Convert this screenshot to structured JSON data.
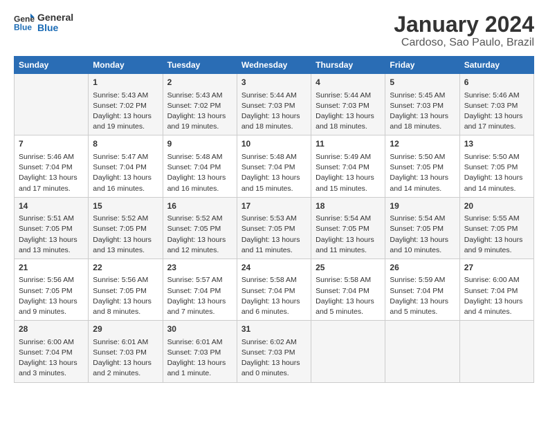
{
  "header": {
    "logo_line1": "General",
    "logo_line2": "Blue",
    "title": "January 2024",
    "subtitle": "Cardoso, Sao Paulo, Brazil"
  },
  "columns": [
    "Sunday",
    "Monday",
    "Tuesday",
    "Wednesday",
    "Thursday",
    "Friday",
    "Saturday"
  ],
  "weeks": [
    [
      {
        "day": "",
        "sunrise": "",
        "sunset": "",
        "daylight": ""
      },
      {
        "day": "1",
        "sunrise": "Sunrise: 5:43 AM",
        "sunset": "Sunset: 7:02 PM",
        "daylight": "Daylight: 13 hours and 19 minutes."
      },
      {
        "day": "2",
        "sunrise": "Sunrise: 5:43 AM",
        "sunset": "Sunset: 7:02 PM",
        "daylight": "Daylight: 13 hours and 19 minutes."
      },
      {
        "day": "3",
        "sunrise": "Sunrise: 5:44 AM",
        "sunset": "Sunset: 7:03 PM",
        "daylight": "Daylight: 13 hours and 18 minutes."
      },
      {
        "day": "4",
        "sunrise": "Sunrise: 5:44 AM",
        "sunset": "Sunset: 7:03 PM",
        "daylight": "Daylight: 13 hours and 18 minutes."
      },
      {
        "day": "5",
        "sunrise": "Sunrise: 5:45 AM",
        "sunset": "Sunset: 7:03 PM",
        "daylight": "Daylight: 13 hours and 18 minutes."
      },
      {
        "day": "6",
        "sunrise": "Sunrise: 5:46 AM",
        "sunset": "Sunset: 7:03 PM",
        "daylight": "Daylight: 13 hours and 17 minutes."
      }
    ],
    [
      {
        "day": "7",
        "sunrise": "Sunrise: 5:46 AM",
        "sunset": "Sunset: 7:04 PM",
        "daylight": "Daylight: 13 hours and 17 minutes."
      },
      {
        "day": "8",
        "sunrise": "Sunrise: 5:47 AM",
        "sunset": "Sunset: 7:04 PM",
        "daylight": "Daylight: 13 hours and 16 minutes."
      },
      {
        "day": "9",
        "sunrise": "Sunrise: 5:48 AM",
        "sunset": "Sunset: 7:04 PM",
        "daylight": "Daylight: 13 hours and 16 minutes."
      },
      {
        "day": "10",
        "sunrise": "Sunrise: 5:48 AM",
        "sunset": "Sunset: 7:04 PM",
        "daylight": "Daylight: 13 hours and 15 minutes."
      },
      {
        "day": "11",
        "sunrise": "Sunrise: 5:49 AM",
        "sunset": "Sunset: 7:04 PM",
        "daylight": "Daylight: 13 hours and 15 minutes."
      },
      {
        "day": "12",
        "sunrise": "Sunrise: 5:50 AM",
        "sunset": "Sunset: 7:05 PM",
        "daylight": "Daylight: 13 hours and 14 minutes."
      },
      {
        "day": "13",
        "sunrise": "Sunrise: 5:50 AM",
        "sunset": "Sunset: 7:05 PM",
        "daylight": "Daylight: 13 hours and 14 minutes."
      }
    ],
    [
      {
        "day": "14",
        "sunrise": "Sunrise: 5:51 AM",
        "sunset": "Sunset: 7:05 PM",
        "daylight": "Daylight: 13 hours and 13 minutes."
      },
      {
        "day": "15",
        "sunrise": "Sunrise: 5:52 AM",
        "sunset": "Sunset: 7:05 PM",
        "daylight": "Daylight: 13 hours and 13 minutes."
      },
      {
        "day": "16",
        "sunrise": "Sunrise: 5:52 AM",
        "sunset": "Sunset: 7:05 PM",
        "daylight": "Daylight: 13 hours and 12 minutes."
      },
      {
        "day": "17",
        "sunrise": "Sunrise: 5:53 AM",
        "sunset": "Sunset: 7:05 PM",
        "daylight": "Daylight: 13 hours and 11 minutes."
      },
      {
        "day": "18",
        "sunrise": "Sunrise: 5:54 AM",
        "sunset": "Sunset: 7:05 PM",
        "daylight": "Daylight: 13 hours and 11 minutes."
      },
      {
        "day": "19",
        "sunrise": "Sunrise: 5:54 AM",
        "sunset": "Sunset: 7:05 PM",
        "daylight": "Daylight: 13 hours and 10 minutes."
      },
      {
        "day": "20",
        "sunrise": "Sunrise: 5:55 AM",
        "sunset": "Sunset: 7:05 PM",
        "daylight": "Daylight: 13 hours and 9 minutes."
      }
    ],
    [
      {
        "day": "21",
        "sunrise": "Sunrise: 5:56 AM",
        "sunset": "Sunset: 7:05 PM",
        "daylight": "Daylight: 13 hours and 9 minutes."
      },
      {
        "day": "22",
        "sunrise": "Sunrise: 5:56 AM",
        "sunset": "Sunset: 7:05 PM",
        "daylight": "Daylight: 13 hours and 8 minutes."
      },
      {
        "day": "23",
        "sunrise": "Sunrise: 5:57 AM",
        "sunset": "Sunset: 7:04 PM",
        "daylight": "Daylight: 13 hours and 7 minutes."
      },
      {
        "day": "24",
        "sunrise": "Sunrise: 5:58 AM",
        "sunset": "Sunset: 7:04 PM",
        "daylight": "Daylight: 13 hours and 6 minutes."
      },
      {
        "day": "25",
        "sunrise": "Sunrise: 5:58 AM",
        "sunset": "Sunset: 7:04 PM",
        "daylight": "Daylight: 13 hours and 5 minutes."
      },
      {
        "day": "26",
        "sunrise": "Sunrise: 5:59 AM",
        "sunset": "Sunset: 7:04 PM",
        "daylight": "Daylight: 13 hours and 5 minutes."
      },
      {
        "day": "27",
        "sunrise": "Sunrise: 6:00 AM",
        "sunset": "Sunset: 7:04 PM",
        "daylight": "Daylight: 13 hours and 4 minutes."
      }
    ],
    [
      {
        "day": "28",
        "sunrise": "Sunrise: 6:00 AM",
        "sunset": "Sunset: 7:04 PM",
        "daylight": "Daylight: 13 hours and 3 minutes."
      },
      {
        "day": "29",
        "sunrise": "Sunrise: 6:01 AM",
        "sunset": "Sunset: 7:03 PM",
        "daylight": "Daylight: 13 hours and 2 minutes."
      },
      {
        "day": "30",
        "sunrise": "Sunrise: 6:01 AM",
        "sunset": "Sunset: 7:03 PM",
        "daylight": "Daylight: 13 hours and 1 minute."
      },
      {
        "day": "31",
        "sunrise": "Sunrise: 6:02 AM",
        "sunset": "Sunset: 7:03 PM",
        "daylight": "Daylight: 13 hours and 0 minutes."
      },
      {
        "day": "",
        "sunrise": "",
        "sunset": "",
        "daylight": ""
      },
      {
        "day": "",
        "sunrise": "",
        "sunset": "",
        "daylight": ""
      },
      {
        "day": "",
        "sunrise": "",
        "sunset": "",
        "daylight": ""
      }
    ]
  ]
}
